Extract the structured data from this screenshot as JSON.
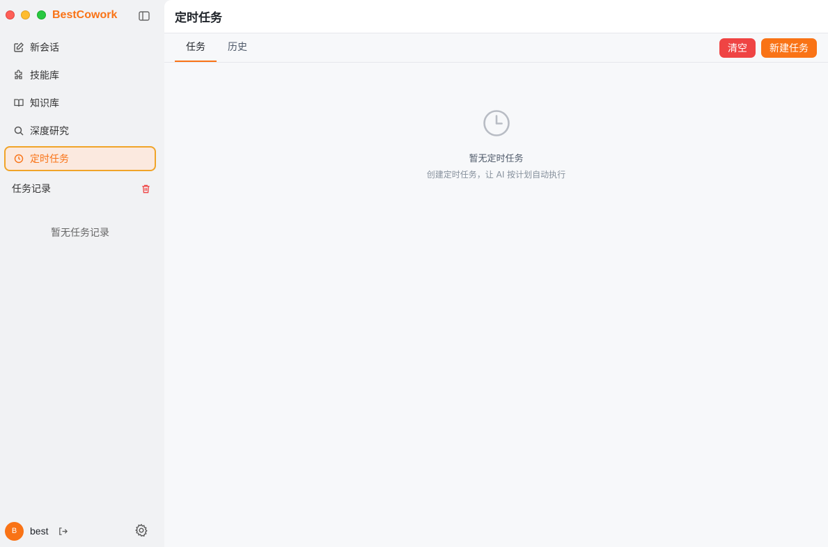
{
  "app": {
    "brand": "BestCowork"
  },
  "sidebar": {
    "items": [
      {
        "label": "新会话",
        "icon": "edit-icon"
      },
      {
        "label": "技能库",
        "icon": "puzzle-icon"
      },
      {
        "label": "知识库",
        "icon": "book-icon"
      },
      {
        "label": "深度研究",
        "icon": "search-icon"
      },
      {
        "label": "定时任务",
        "icon": "clock-icon",
        "active": true
      }
    ],
    "section_title": "任务记录",
    "section_empty": "暂无任务记录"
  },
  "user": {
    "avatar_initial": "B",
    "name": "best"
  },
  "main": {
    "title": "定时任务",
    "tabs": [
      {
        "label": "任务",
        "active": true
      },
      {
        "label": "历史"
      }
    ],
    "clear_label": "清空",
    "new_label": "新建任务",
    "empty_title": "暂无定时任务",
    "empty_subtitle": "创建定时任务，让 AI 按计划自动执行"
  },
  "colors": {
    "accent": "#f97316",
    "danger": "#ef4444",
    "active_bg": "#fbe9df",
    "active_border": "#f0a428"
  }
}
